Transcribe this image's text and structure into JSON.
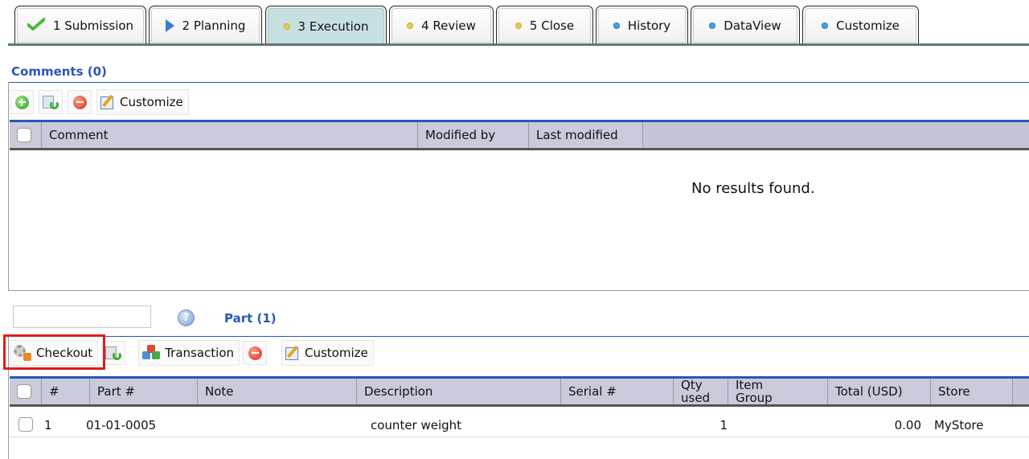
{
  "tabs": [
    {
      "label": "1 Submission",
      "icon": "check-icon",
      "active": false
    },
    {
      "label": "2 Planning",
      "icon": "play-arrow-icon",
      "active": false
    },
    {
      "label": "3 Execution",
      "icon": "yellow-dot-icon",
      "active": true
    },
    {
      "label": "4 Review",
      "icon": "yellow-dot-icon",
      "active": false
    },
    {
      "label": "5 Close",
      "icon": "yellow-dot-icon",
      "active": false
    },
    {
      "label": "History",
      "icon": "blue-dot-icon",
      "active": false
    },
    {
      "label": "DataView",
      "icon": "blue-dot-icon",
      "active": false
    },
    {
      "label": "Customize",
      "icon": "blue-dot-icon",
      "active": false
    }
  ],
  "comments": {
    "title": "Comments (0)",
    "toolbar": {
      "customize_label": "Customize"
    },
    "columns": [
      "Comment",
      "Modified by",
      "Last modified"
    ],
    "empty_message": "No results found."
  },
  "parts": {
    "filter_value": "",
    "help_glyph": "?",
    "title": "Part (1)",
    "toolbar": {
      "checkout_label": "Checkout",
      "transaction_label": "Transaction",
      "customize_label": "Customize"
    },
    "columns": {
      "num": "#",
      "part": "Part #",
      "note": "Note",
      "description": "Description",
      "serial": "Serial #",
      "qty_line1": "Qty",
      "qty_line2": "used",
      "group_line1": "Item",
      "group_line2": "Group",
      "total": "Total (USD)",
      "store": "Store"
    },
    "rows": [
      {
        "num": "1",
        "part": "01-01-0005",
        "note": "",
        "description": "counter weight",
        "serial": "",
        "qty": "1",
        "group": "",
        "total": "0.00",
        "store": "MyStore"
      }
    ]
  },
  "colors": {
    "accent": "#2c55b8",
    "active_tab": "#c6e0df",
    "highlight": "#e01b1b",
    "table_header": "#c9cbda"
  }
}
